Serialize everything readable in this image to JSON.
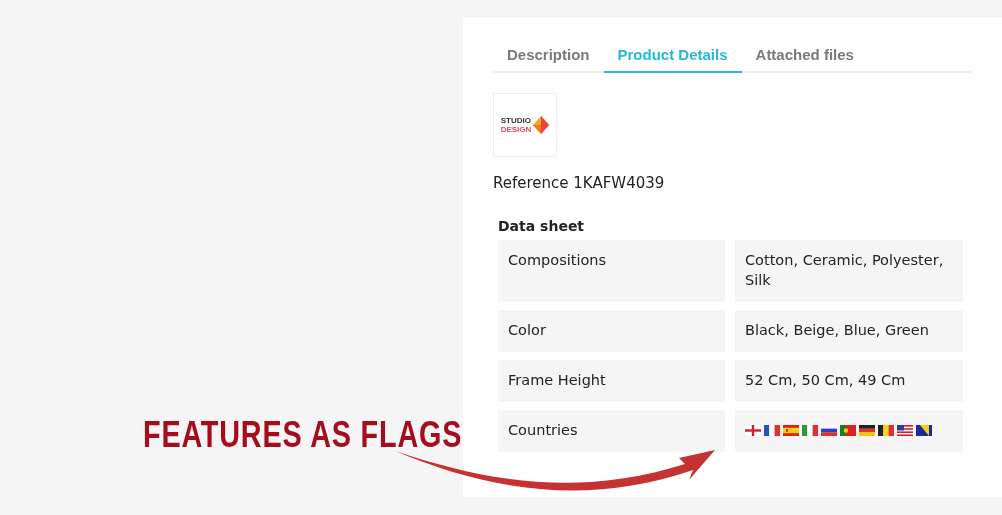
{
  "headline": "FEATURES AS FLAGS",
  "tabs": [
    {
      "label": "Description",
      "selected": false
    },
    {
      "label": "Product Details",
      "selected": true
    },
    {
      "label": "Attached files",
      "selected": false
    }
  ],
  "brand_logo": {
    "line_1": "STUDIO",
    "line_2": "DESIGN"
  },
  "reference": "Reference 1KAFW4039",
  "data_sheet": {
    "title": "Data sheet",
    "rows": [
      {
        "label": "Compositions",
        "kind": "text",
        "value": "Cotton, Ceramic, Polyester, Silk"
      },
      {
        "label": "Color",
        "kind": "text",
        "value": "Black, Beige, Blue, Green"
      },
      {
        "label": "Frame Height",
        "kind": "text",
        "value": "52 Cm, 50 Cm, 49 Cm"
      },
      {
        "label": "Countries",
        "kind": "flags",
        "flags": [
          {
            "kind": "england"
          },
          {
            "kind": "france"
          },
          {
            "kind": "spain"
          },
          {
            "kind": "italy"
          },
          {
            "kind": "russia"
          },
          {
            "kind": "portugal"
          },
          {
            "kind": "germany"
          },
          {
            "kind": "belgium"
          },
          {
            "kind": "usa"
          },
          {
            "kind": "bosnia"
          }
        ]
      }
    ]
  }
}
